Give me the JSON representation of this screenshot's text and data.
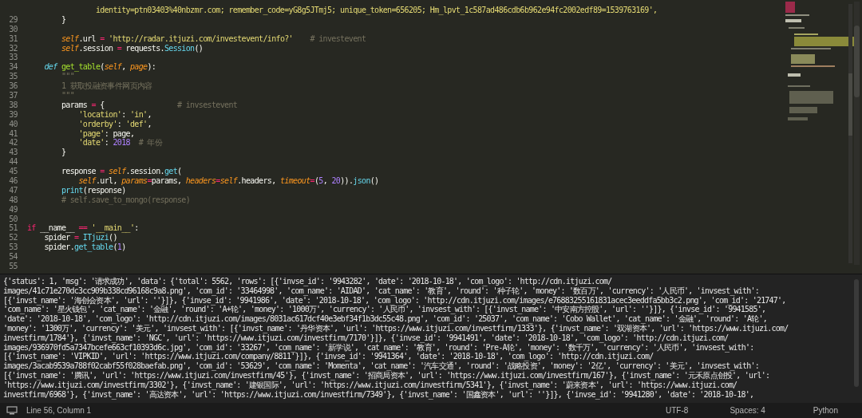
{
  "editor": {
    "lines": [
      {
        "tokens": [
          {
            "text": "                identity=ptn03403%40nbzmr.com; remember_code=yG8g5JTmj5; unique_token=656205; Hm_lpvt_1c587ad486cdb6b962e94fc2002edf89=1539763169',",
            "kind": "str"
          }
        ]
      },
      {
        "number": "29",
        "tokens": [
          {
            "text": "        }",
            "kind": "plain"
          }
        ]
      },
      {
        "number": "30"
      },
      {
        "number": "31",
        "tokens": [
          {
            "text": "        self",
            "kind": "self"
          },
          {
            "text": ".url ",
            "kind": "plain"
          },
          {
            "text": "=",
            "kind": "op"
          },
          {
            "text": " 'http://radar.itjuzi.com/investevent/info?'",
            "kind": "str"
          },
          {
            "text": "    # investevent",
            "kind": "cm"
          }
        ]
      },
      {
        "number": "32",
        "tokens": [
          {
            "text": "        self",
            "kind": "self"
          },
          {
            "text": ".session ",
            "kind": "plain"
          },
          {
            "text": "=",
            "kind": "op"
          },
          {
            "text": " requests.",
            "kind": "plain"
          },
          {
            "text": "Session",
            "kind": "call"
          },
          {
            "text": "()",
            "kind": "plain"
          }
        ]
      },
      {
        "number": "33"
      },
      {
        "number": "34",
        "tokens": [
          {
            "text": "    def ",
            "kind": "kw"
          },
          {
            "text": "get_table",
            "kind": "fn"
          },
          {
            "text": "(",
            "kind": "plain"
          },
          {
            "text": "self",
            "kind": "param"
          },
          {
            "text": ", ",
            "kind": "plain"
          },
          {
            "text": "page",
            "kind": "param"
          },
          {
            "text": "):",
            "kind": "plain"
          }
        ]
      },
      {
        "number": "35",
        "tokens": [
          {
            "text": "        \"\"\"",
            "kind": "cm"
          }
        ]
      },
      {
        "number": "36",
        "tokens": [
          {
            "text": "        1 获取投融资事件网页内容",
            "kind": "cm"
          }
        ]
      },
      {
        "number": "37",
        "tokens": [
          {
            "text": "        \"\"\"",
            "kind": "cm"
          }
        ]
      },
      {
        "number": "38",
        "tokens": [
          {
            "text": "        params ",
            "kind": "plain"
          },
          {
            "text": "=",
            "kind": "op"
          },
          {
            "text": " {                 ",
            "kind": "plain"
          },
          {
            "text": "# invsestevent",
            "kind": "cm"
          }
        ]
      },
      {
        "number": "39",
        "tokens": [
          {
            "text": "            'location'",
            "kind": "str"
          },
          {
            "text": ": ",
            "kind": "plain"
          },
          {
            "text": "'in'",
            "kind": "str"
          },
          {
            "text": ",",
            "kind": "plain"
          }
        ]
      },
      {
        "number": "40",
        "tokens": [
          {
            "text": "            'orderby'",
            "kind": "str"
          },
          {
            "text": ": ",
            "kind": "plain"
          },
          {
            "text": "'def'",
            "kind": "str"
          },
          {
            "text": ",",
            "kind": "plain"
          }
        ]
      },
      {
        "number": "41",
        "tokens": [
          {
            "text": "            'page'",
            "kind": "str"
          },
          {
            "text": ": page,",
            "kind": "plain"
          }
        ]
      },
      {
        "number": "42",
        "tokens": [
          {
            "text": "            'date'",
            "kind": "str"
          },
          {
            "text": ": ",
            "kind": "plain"
          },
          {
            "text": "2018",
            "kind": "num"
          },
          {
            "text": "  # 年份",
            "kind": "cm"
          }
        ]
      },
      {
        "number": "43",
        "tokens": [
          {
            "text": "        }",
            "kind": "plain"
          }
        ]
      },
      {
        "number": "44"
      },
      {
        "number": "45",
        "tokens": [
          {
            "text": "        response ",
            "kind": "plain"
          },
          {
            "text": "= ",
            "kind": "op"
          },
          {
            "text": "self",
            "kind": "self"
          },
          {
            "text": ".session.",
            "kind": "plain"
          },
          {
            "text": "get",
            "kind": "call"
          },
          {
            "text": "(",
            "kind": "plain"
          }
        ]
      },
      {
        "number": "46",
        "tokens": [
          {
            "text": "            self",
            "kind": "self"
          },
          {
            "text": ".url, ",
            "kind": "plain"
          },
          {
            "text": "params",
            "kind": "param"
          },
          {
            "text": "=",
            "kind": "op"
          },
          {
            "text": "params, ",
            "kind": "plain"
          },
          {
            "text": "headers",
            "kind": "param"
          },
          {
            "text": "=",
            "kind": "op"
          },
          {
            "text": "self",
            "kind": "self"
          },
          {
            "text": ".headers, ",
            "kind": "plain"
          },
          {
            "text": "timeout",
            "kind": "param"
          },
          {
            "text": "=",
            "kind": "op"
          },
          {
            "text": "(",
            "kind": "plain"
          },
          {
            "text": "5",
            "kind": "num"
          },
          {
            "text": ", ",
            "kind": "plain"
          },
          {
            "text": "20",
            "kind": "num"
          },
          {
            "text": ")).",
            "kind": "plain"
          },
          {
            "text": "json",
            "kind": "call"
          },
          {
            "text": "()",
            "kind": "plain"
          }
        ]
      },
      {
        "number": "47",
        "tokens": [
          {
            "text": "        print",
            "kind": "call"
          },
          {
            "text": "(response)",
            "kind": "plain"
          }
        ]
      },
      {
        "number": "48",
        "tokens": [
          {
            "text": "        # self.save_to_mongo(response)",
            "kind": "cm"
          }
        ]
      },
      {
        "number": "49"
      },
      {
        "number": "50"
      },
      {
        "number": "51",
        "tokens": [
          {
            "text": "if",
            "kind": "op"
          },
          {
            "text": " __name__ ",
            "kind": "plain"
          },
          {
            "text": "==",
            "kind": "op"
          },
          {
            "text": " '__main__'",
            "kind": "str"
          },
          {
            "text": ":",
            "kind": "plain"
          }
        ]
      },
      {
        "number": "52",
        "tokens": [
          {
            "text": "    spider ",
            "kind": "plain"
          },
          {
            "text": "= ",
            "kind": "op"
          },
          {
            "text": "ITjuzi",
            "kind": "call"
          },
          {
            "text": "()",
            "kind": "plain"
          }
        ]
      },
      {
        "number": "53",
        "tokens": [
          {
            "text": "    spider.",
            "kind": "plain"
          },
          {
            "text": "get_table",
            "kind": "call"
          },
          {
            "text": "(",
            "kind": "plain"
          },
          {
            "text": "1",
            "kind": "num"
          },
          {
            "text": ")",
            "kind": "plain"
          }
        ]
      },
      {
        "number": "54"
      },
      {
        "number": "55"
      }
    ]
  },
  "output_panel": {
    "lines": [
      "{'status': 1, 'msg': '请求成功', 'data': {'total': 5562, 'rows': [{'invse_id': '9943282', 'date': '2018-10-18', 'com_logo': 'http://cdn.itjuzi.com/",
      "images/41c71e270dc3cc909b338cd96168c9a8.png', 'com_id': '33464998', 'com_name': 'AIDAD', 'cat_name': '教育', 'round': '种子轮', 'money': '数百万', 'currency': '人民币', 'invsest_with':",
      "[{'invst_name': '海创会资本', 'url': ''}]}, {'invse_id': '9941986', 'date': '2018-10-18', 'com_logo': 'http://cdn.itjuzi.com/images/e76883255161831acec3eeddfa5bb3c2.png', 'com_id': '21747',",
      "'com_name': '星火钱包', 'cat_name': '金融', 'round': 'A+轮', 'money': '1000万', 'currency': '人民币', 'invsest_with': [{'invst_name': '中安南方控股', 'url': ''}]}, {'invse_id': '9941585',",
      "'date': '2018-10-18', 'com_logo': 'http://cdn.itjuzi.com/images/8031ac617dcf40e3ebf34f1b3dc55c48.png', 'com_id': '25037', 'com_name': 'Cobo Wallet', 'cat_name': '金融', 'round': 'A轮',",
      "'money': '1300万', 'currency': '美元', 'invsest_with': [{'invst_name': '丹华资本', 'url': 'https://www.itjuzi.com/investfirm/1333'}, {'invst_name': '双湖资本', 'url': 'https://www.itjuzi.com/",
      "investfirm/1784'}, {'invst_name': 'NGC', 'url': 'https://www.itjuzi.com/investfirm/7170'}]}, {'invse_id': '9941491', 'date': '2018-10-18', 'com_logo': 'http://cdn.itjuzi.com/",
      "images/936970fd5a7347bcefe663cf10393d6c.jpg', 'com_id': '33267', 'com_name': '新学说', 'cat_name': '教育', 'round': 'Pre-A轮', 'money': '数千万', 'currency': '人民币', 'invsest_with':",
      "[{'invst_name': 'VIPKID', 'url': 'https://www.itjuzi.com/company/8811'}]}, {'invse_id': '9941364', 'date': '2018-10-18', 'com_logo': 'http://cdn.itjuzi.com/",
      "images/3acab9539a788f02cabf55f028baefab.png', 'com_id': '53629', 'com_name': 'Momenta', 'cat_name': '汽车交通', 'round': '战略投资', 'money': '2亿', 'currency': '美元', 'invsest_with':",
      "[{'invst_name': '腾讯', 'url': 'https://www.itjuzi.com/investfirm/45'}, {'invst_name': '招商局资本', 'url': 'https://www.itjuzi.com/investfirm/167'}, {'invst_name': '元禾原点创投', 'url':",
      "'https://www.itjuzi.com/investfirm/3302'}, {'invst_name': '建银国际', 'url': 'https://www.itjuzi.com/investfirm/5341'}, {'invst_name': '蔚来资本', 'url': 'https://www.itjuzi.com/",
      "investfirm/6968'}, {'invst_name': '高达资本', 'url': 'https://www.itjuzi.com/investfirm/7349'}, {'invst_name': '国鑫资本', 'url': ''}]}, {'invse_id': '9941280', 'date': '2018-10-18',"
    ]
  },
  "status_bar": {
    "position": "Line 56, Column 1",
    "encoding": "UTF-8",
    "indentation": "Spaces: 4",
    "syntax": "Python"
  }
}
